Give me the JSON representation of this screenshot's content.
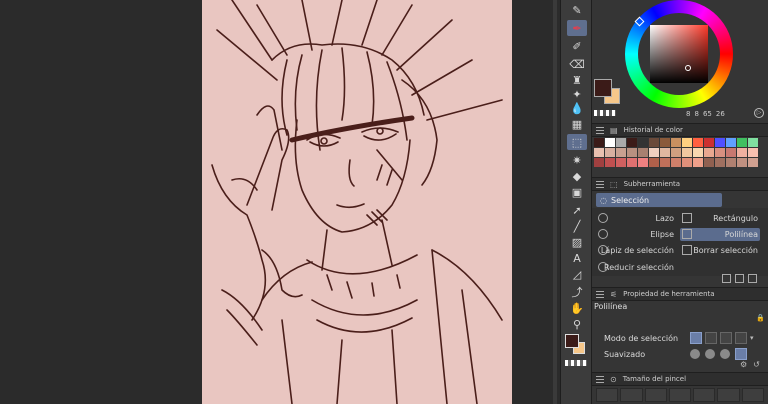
{
  "toolbar": {
    "tools": [
      {
        "id": "pen",
        "icon": "pen-icon"
      },
      {
        "id": "brush",
        "icon": "brush-icon",
        "color": "#e04050"
      },
      {
        "id": "airbrush",
        "icon": "airbrush-icon"
      },
      {
        "id": "eraser",
        "icon": "eraser-icon"
      },
      {
        "id": "decoration",
        "icon": "decoration-icon"
      },
      {
        "id": "sparkle",
        "icon": "sparkle-icon"
      },
      {
        "id": "blend",
        "icon": "blend-icon"
      },
      {
        "id": "frame",
        "icon": "frame-border-icon"
      },
      {
        "id": "selection",
        "icon": "selection-lasso-icon",
        "active": true
      },
      {
        "id": "auto-select",
        "icon": "magic-wand-icon"
      },
      {
        "id": "fill",
        "icon": "fill-bucket-icon"
      },
      {
        "id": "gradient",
        "icon": "gradient-icon"
      },
      {
        "id": "object",
        "icon": "object-select-icon"
      },
      {
        "id": "figure",
        "icon": "line-figure-icon"
      },
      {
        "id": "ruler",
        "icon": "ruler-icon"
      },
      {
        "id": "text",
        "icon": "text-icon"
      },
      {
        "id": "balloon",
        "icon": "balloon-icon"
      },
      {
        "id": "correct",
        "icon": "correct-line-icon"
      },
      {
        "id": "move",
        "icon": "hand-icon"
      },
      {
        "id": "eyedropper",
        "icon": "eyedropper-icon"
      }
    ]
  },
  "colors": {
    "main": "#3b1b18",
    "sub": "#f6c78a",
    "canvas_bg": "#e9c6c1",
    "line": "#4a1e1a",
    "accent": "#5b6c8e"
  },
  "color_wheel": {
    "readout": [
      "8",
      "8",
      "65",
      "26"
    ]
  },
  "color_history": {
    "title": "Historial de color",
    "swatches": [
      "#3b1b18",
      "#ffffff",
      "#aaaaaa",
      "#3b1b18",
      "#333333",
      "#6a4a3a",
      "#8a5a3a",
      "#c89060",
      "#ffd080",
      "#ff6040",
      "#cc3030",
      "#5050ff",
      "#60a0ff",
      "#40c060",
      "#80e0a0",
      "#e8c0b0",
      "#d8b0a0",
      "#c8a090",
      "#b89080",
      "#a88070",
      "#f0d0c0",
      "#e0b8a0",
      "#d0a080",
      "#f0c8a0",
      "#f8d8b0",
      "#e8a890",
      "#d89080",
      "#c87870",
      "#f0b0a0",
      "#f8c0b0",
      "#a04040",
      "#c05050",
      "#d06060",
      "#e07070",
      "#f08080",
      "#b0604a",
      "#c0705a",
      "#d0806a",
      "#e0907a",
      "#f0a08a",
      "#906050",
      "#a07060",
      "#b08070",
      "#c09080",
      "#d0a090"
    ]
  },
  "subtool": {
    "title": "Subherramienta",
    "group": "Selección",
    "items": [
      {
        "label": "Lazo",
        "side": "left"
      },
      {
        "label": "Rectángulo",
        "side": "right"
      },
      {
        "label": "Elipse",
        "side": "left"
      },
      {
        "label": "Polilínea",
        "side": "right",
        "selected": true
      },
      {
        "label": "Lápiz de selección",
        "side": "left"
      },
      {
        "label": "Borrar selección",
        "side": "right"
      },
      {
        "label": "Reducir selección",
        "side": "left"
      }
    ]
  },
  "tool_property": {
    "title": "Propiedad de herramienta",
    "tool_name": "Polilínea",
    "mode_label": "Modo de selección",
    "smooth_label": "Suavizado"
  },
  "brush_size": {
    "title": "Tamaño del pincel"
  }
}
